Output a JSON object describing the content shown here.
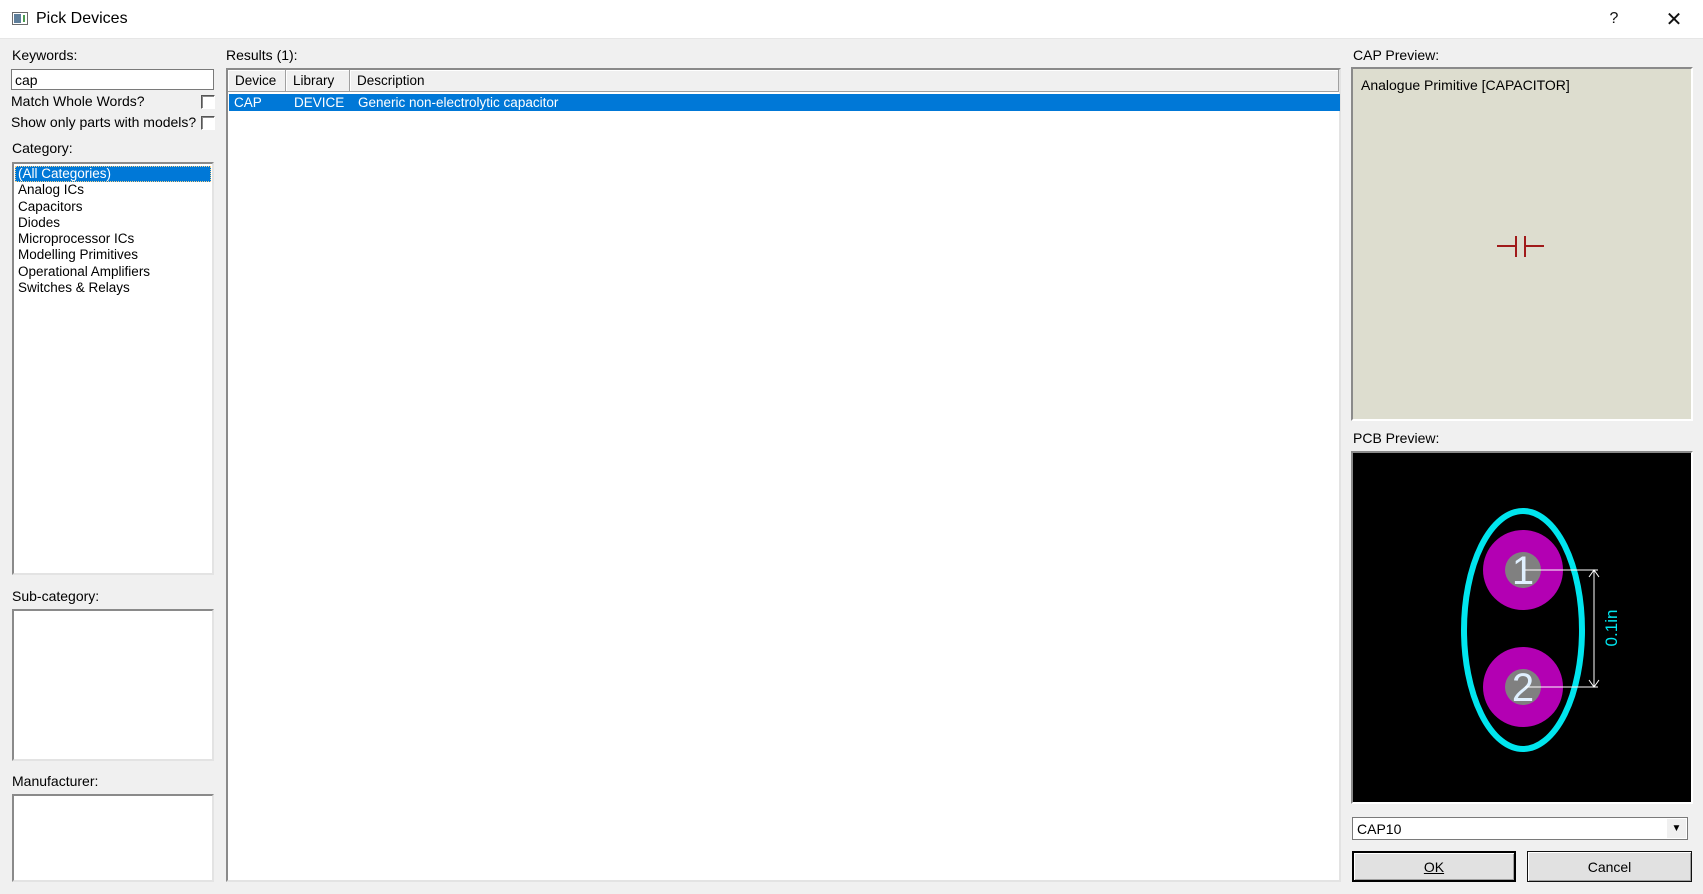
{
  "window": {
    "title": "Pick Devices",
    "help_label": "?",
    "close_label": "✕"
  },
  "keywords": {
    "label": "Keywords:",
    "value": "cap"
  },
  "options": {
    "match_whole_words": {
      "label": "Match Whole Words?",
      "checked": false
    },
    "show_only_models": {
      "label": "Show only parts with models?",
      "checked": false
    }
  },
  "category": {
    "label": "Category:",
    "items": [
      {
        "label": "(All Categories)",
        "selected": true
      },
      {
        "label": "Analog ICs"
      },
      {
        "label": "Capacitors"
      },
      {
        "label": "Diodes"
      },
      {
        "label": "Microprocessor ICs"
      },
      {
        "label": "Modelling Primitives"
      },
      {
        "label": "Operational Amplifiers"
      },
      {
        "label": "Switches & Relays"
      }
    ]
  },
  "subcategory": {
    "label": "Sub-category:"
  },
  "manufacturer": {
    "label": "Manufacturer:"
  },
  "results": {
    "label": "Results (1):",
    "columns": [
      "Device",
      "Library",
      "Description"
    ],
    "rows": [
      {
        "device": "CAP",
        "library": "DEVICE",
        "description": "Generic non-electrolytic capacitor"
      }
    ]
  },
  "cap_preview": {
    "label": "CAP Preview:",
    "text": "Analogue Primitive [CAPACITOR]",
    "symbol_color": "#a01a1a",
    "background_color": "#ddddcf"
  },
  "pcb_preview": {
    "label": "PCB Preview:",
    "pad_labels": [
      "1",
      "2"
    ],
    "dimension_label": "0.1in",
    "outline_color": "#00e5ee",
    "pad_color": "#b300b3",
    "drill_color": "#808080"
  },
  "footprint": {
    "selected": "CAP10"
  },
  "buttons": {
    "ok": "OK",
    "cancel": "Cancel"
  },
  "colors": {
    "selection": "#0078d7"
  }
}
